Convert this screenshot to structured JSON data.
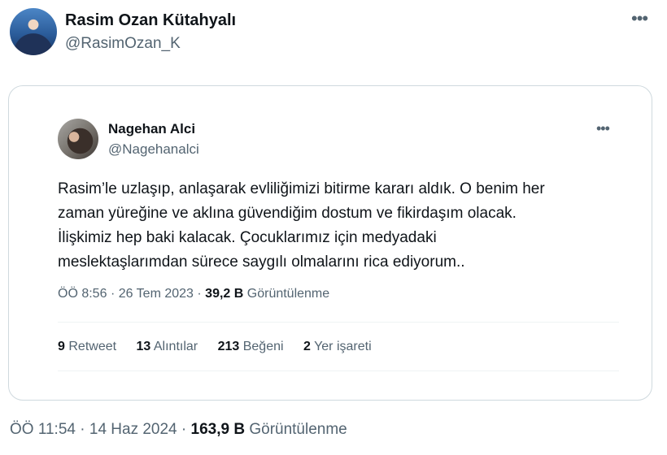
{
  "author": {
    "name": "Rasim Ozan Kütahyalı",
    "handle": "@RasimOzan_K"
  },
  "more_icon": "more-horizontal-icon",
  "quoted_tweet": {
    "author": {
      "name": "Nagehan Alci",
      "handle": "@Nagehanalci"
    },
    "text_lines": [
      "Rasim’le uzlaşıp, anlaşarak evliliğimizi bitirme kararı aldık. O benim her",
      "zaman yüreğine ve aklına güvendiğim dostum ve fikirdaşım olacak.",
      "İlişkimiz hep baki kalacak. Çocuklarımız için medyadaki",
      "meslektaşlarımdan sürece saygılı olmalarını rica ediyorum.."
    ],
    "time": "ÖÖ 8:56",
    "date": "26 Tem 2023",
    "views_count": "39,2 B",
    "views_label": "Görüntülenme",
    "stats": {
      "retweets_count": "9",
      "retweets_label": "Retweet",
      "quotes_count": "13",
      "quotes_label": "Alıntılar",
      "likes_count": "213",
      "likes_label": "Beğeni",
      "bookmarks_count": "2",
      "bookmarks_label": "Yer işareti"
    }
  },
  "meta": {
    "time": "ÖÖ 11:54",
    "date": "14 Haz 2024",
    "views_count": "163,9 B",
    "views_label": "Görüntülenme"
  },
  "separator": "·"
}
